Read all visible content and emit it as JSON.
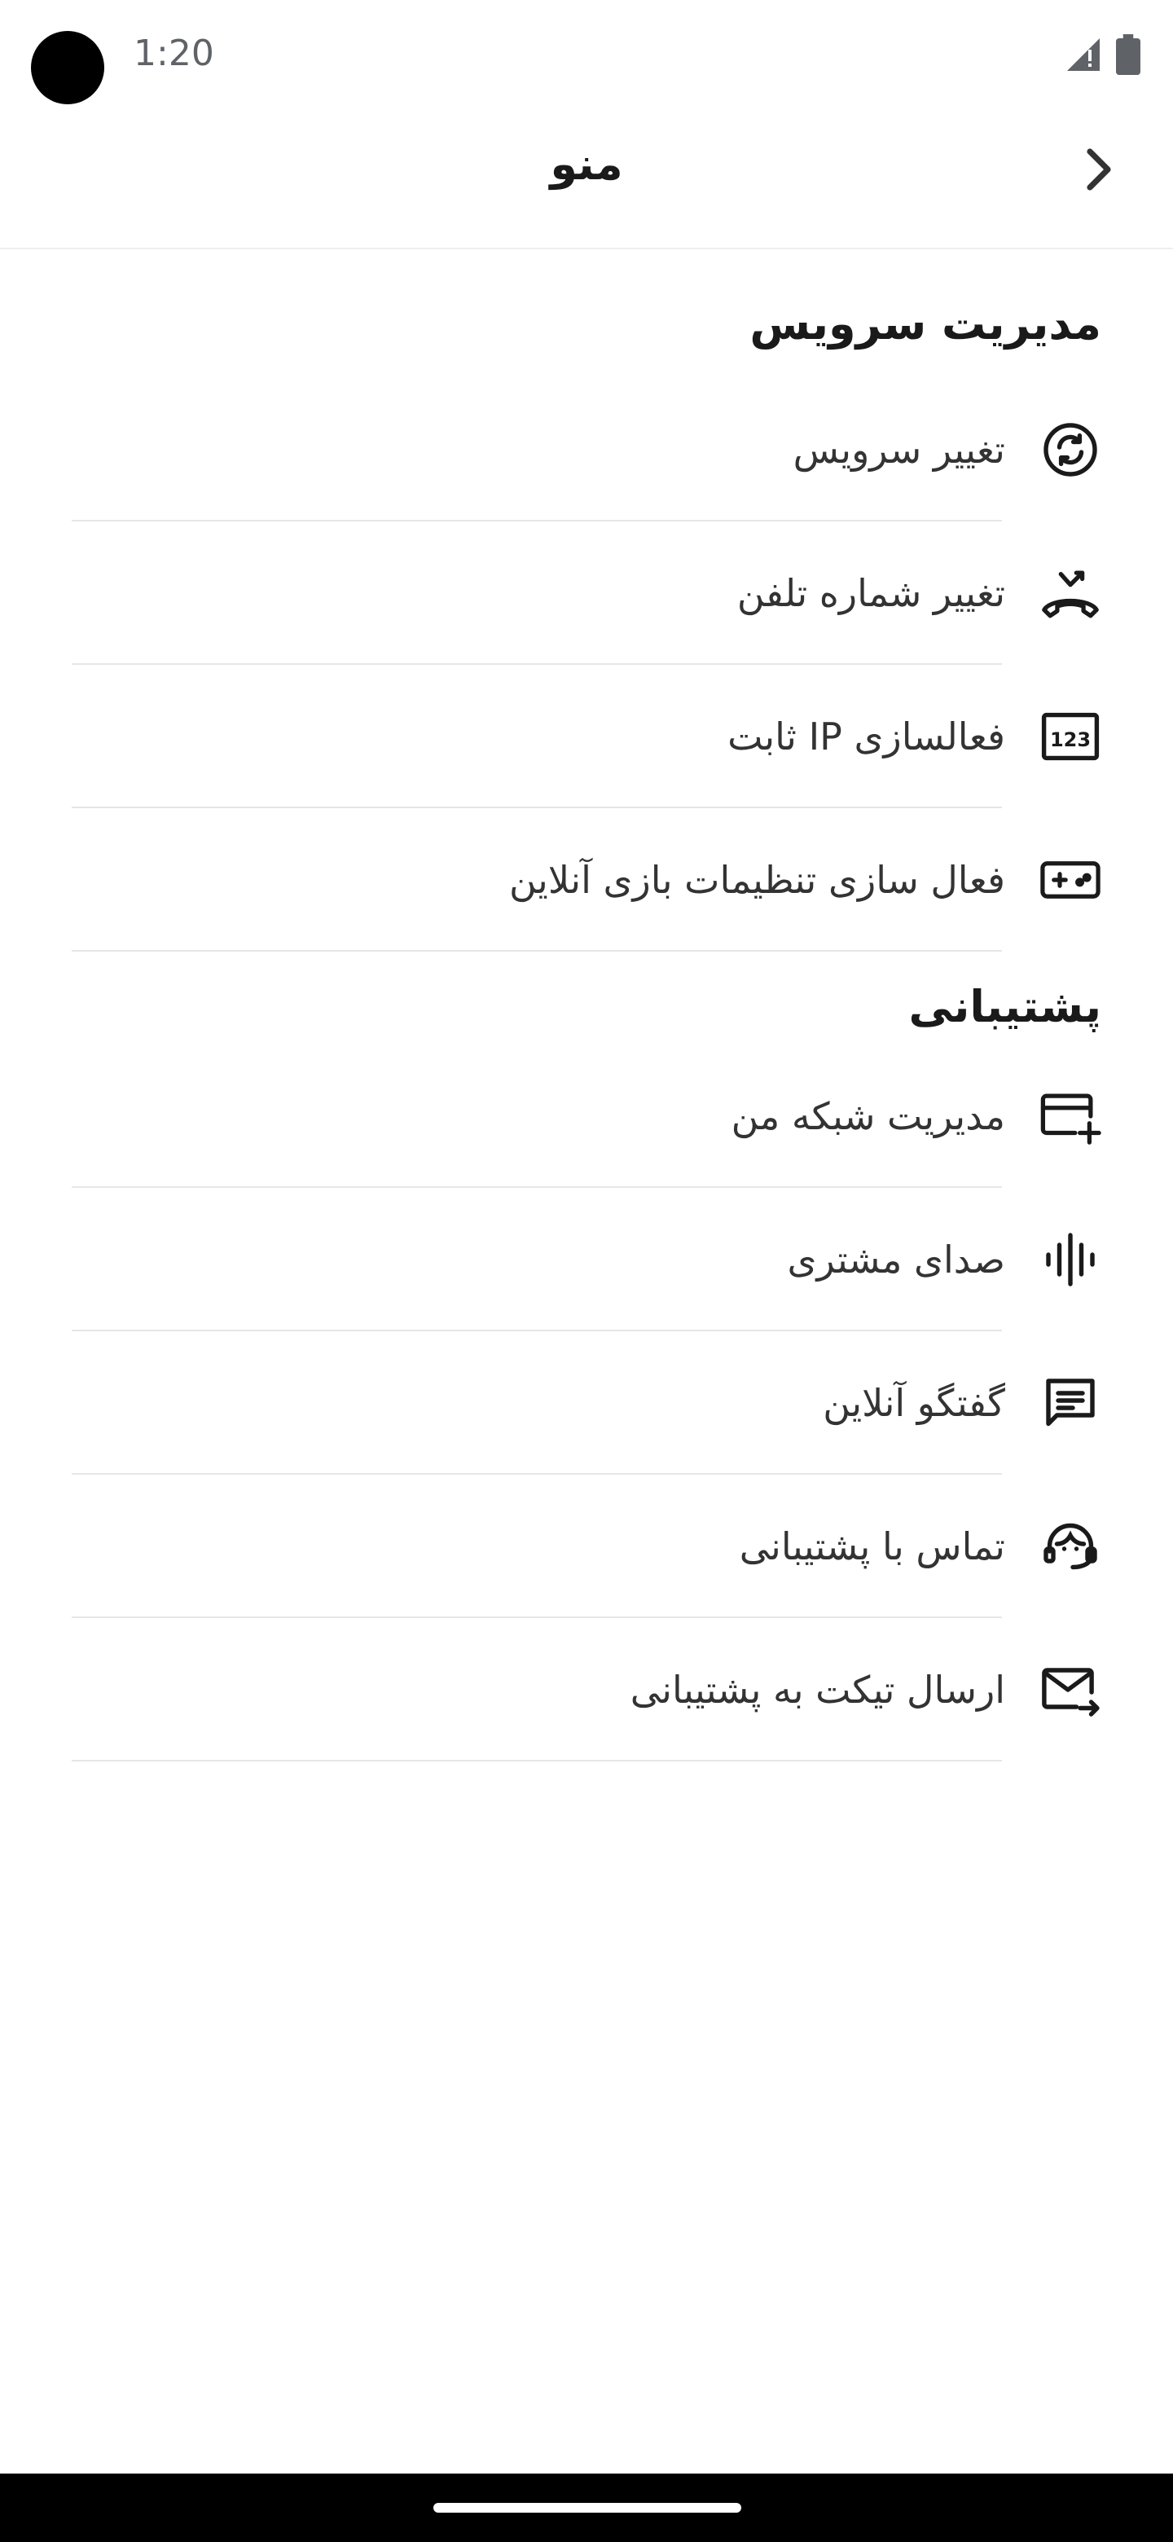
{
  "status_bar": {
    "time": "1:20",
    "icons": [
      "signal-icon",
      "battery-icon"
    ]
  },
  "header": {
    "title": "منو",
    "back_icon": "chevron-right-icon"
  },
  "sections": [
    {
      "title": "مدیریت سرویس",
      "items": [
        {
          "label": "تغییر سرویس",
          "icon": "sync-icon"
        },
        {
          "label": "تغییر شماره تلفن",
          "icon": "phone-change-icon"
        },
        {
          "label": "فعالسازی IP ثابت",
          "icon": "numbers-123-icon"
        },
        {
          "label": "فعال سازی تنظیمات بازی آنلاین",
          "icon": "gamepad-icon"
        }
      ]
    },
    {
      "title": "پشتیبانی",
      "items": [
        {
          "label": "مدیریت شبکه من",
          "icon": "card-add-icon"
        },
        {
          "label": "صدای مشتری",
          "icon": "voice-wave-icon"
        },
        {
          "label": "گفتگو آنلاین",
          "icon": "chat-icon"
        },
        {
          "label": "تماس با پشتیبانی",
          "icon": "support-agent-icon"
        },
        {
          "label": "ارسال تیکت به پشتیبانی",
          "icon": "mail-send-icon"
        }
      ]
    }
  ]
}
